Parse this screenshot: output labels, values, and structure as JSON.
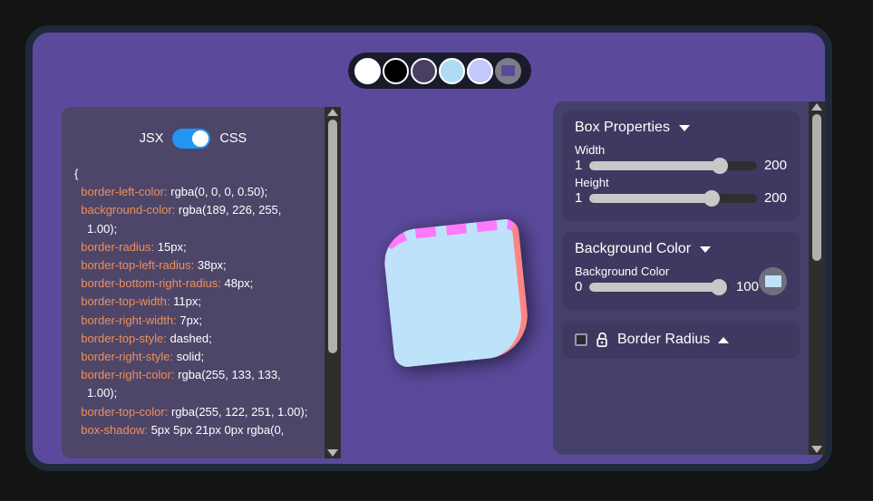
{
  "window": {
    "background_color": "#141414",
    "frame_color": "#5b4a9c",
    "frame_border_color": "#1e2a3a"
  },
  "swatch_bar": {
    "name": "color-palette-bar",
    "swatches": [
      {
        "name": "swatch-white",
        "color": "#ffffff"
      },
      {
        "name": "swatch-black",
        "color": "#000000"
      },
      {
        "name": "swatch-dark-purple",
        "color": "#4a3f63"
      },
      {
        "name": "swatch-light-blue",
        "color": "#aedcf5"
      },
      {
        "name": "swatch-periwinkle",
        "color": "#c5c8fa"
      },
      {
        "name": "swatch-color-picker",
        "color": "#7d7d8a"
      }
    ]
  },
  "code_panel": {
    "toggle": {
      "left_label": "JSX",
      "right_label": "CSS",
      "active": "CSS",
      "accent_color": "#2196f3"
    },
    "lines": [
      {
        "prop": "",
        "val": "{"
      },
      {
        "prop": "border-left-color:",
        "val": "rgba(0, 0, 0, 0.50);"
      },
      {
        "prop": "background-color:",
        "val": "rgba(189, 226, 255, 1.00);"
      },
      {
        "prop": "border-radius:",
        "val": "15px;"
      },
      {
        "prop": "border-top-left-radius:",
        "val": "38px;"
      },
      {
        "prop": "border-bottom-right-radius:",
        "val": "48px;"
      },
      {
        "prop": "border-top-width:",
        "val": "11px;"
      },
      {
        "prop": "border-right-width:",
        "val": "7px;"
      },
      {
        "prop": "border-top-style:",
        "val": "dashed;"
      },
      {
        "prop": "border-right-style:",
        "val": "solid;"
      },
      {
        "prop": "border-right-color:",
        "val": "rgba(255, 133, 133, 1.00);"
      },
      {
        "prop": "border-top-color:",
        "val": "rgba(255, 122, 251, 1.00);"
      },
      {
        "prop": "box-shadow:",
        "val": "5px 5px 21px 0px rgba(0,"
      }
    ]
  },
  "preview": {
    "name": "preview-box",
    "background_color": "rgba(189, 226, 255, 1.00)",
    "border_top_color": "rgba(255, 122, 251, 1.00)",
    "border_right_color": "rgba(255, 133, 133, 1.00)",
    "border_top_style": "dashed",
    "border_right_style": "solid",
    "border_top_width": "11px",
    "border_right_width": "7px",
    "border_radius": "15px",
    "border_top_left_radius": "38px",
    "border_bottom_right_radius": "48px",
    "box_shadow": "5px 5px 21px 0px rgba(0, 0, 0, 0.50)"
  },
  "controls": {
    "box_properties": {
      "title": "Box Properties",
      "caret": "chevron-down-icon",
      "fields": [
        {
          "label": "Width",
          "min": "1",
          "max": "200",
          "percent": 78
        },
        {
          "label": "Height",
          "min": "1",
          "max": "200",
          "percent": 73
        }
      ]
    },
    "background_color": {
      "title": "Background Color",
      "caret": "chevron-down-icon",
      "field_label": "Background Color",
      "min": "0",
      "max": "100",
      "percent": 93,
      "swatch_color": "#bfe2fb"
    },
    "border_radius": {
      "title": "Border Radius",
      "caret": "chevron-up-icon",
      "lock_icon": "unlocked-padlock-icon",
      "checkbox_checked": false
    }
  },
  "scrollbars": {
    "code": {
      "name": "code-panel-scrollbar",
      "up": "arrow-up-icon",
      "down": "arrow-down-icon"
    },
    "controls": {
      "name": "controls-scrollbar",
      "up": "arrow-up-icon",
      "down": "arrow-down-icon"
    }
  }
}
